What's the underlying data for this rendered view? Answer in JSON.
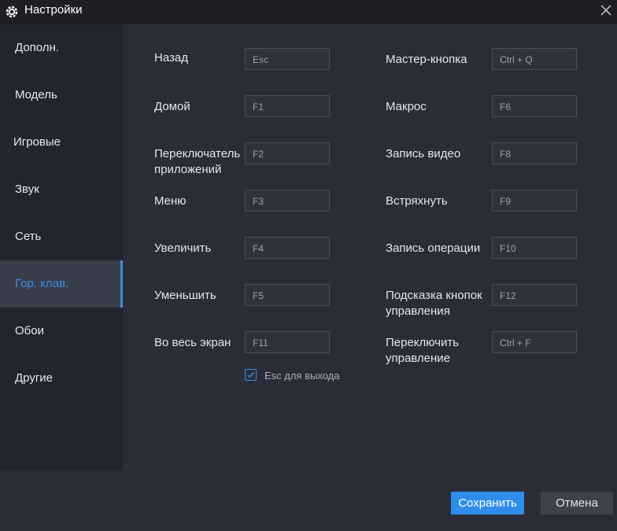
{
  "window": {
    "title": "Настройки"
  },
  "sidebar": {
    "items": [
      {
        "label": "Дополн."
      },
      {
        "label": "Модель"
      },
      {
        "label": "Игровые"
      },
      {
        "label": "Звук"
      },
      {
        "label": "Сеть"
      },
      {
        "label": "Гор. клав.",
        "active": true
      },
      {
        "label": "Обои"
      },
      {
        "label": "Другие"
      }
    ]
  },
  "hotkeys": {
    "left": [
      {
        "label": "Назад",
        "key": "Esc"
      },
      {
        "label": "Домой",
        "key": "F1"
      },
      {
        "label": "Переключатель приложений",
        "key": "F2"
      },
      {
        "label": "Меню",
        "key": "F3"
      },
      {
        "label": "Увеличить",
        "key": "F4"
      },
      {
        "label": "Уменьшить",
        "key": "F5"
      },
      {
        "label": "Во весь экран",
        "key": "F11"
      }
    ],
    "right": [
      {
        "label": "Мастер-кнопка",
        "key": "Ctrl + Q"
      },
      {
        "label": "Макрос",
        "key": "F6"
      },
      {
        "label": "Запись видео",
        "key": "F8"
      },
      {
        "label": "Встряхнуть",
        "key": "F9"
      },
      {
        "label": "Запись операции",
        "key": "F10"
      },
      {
        "label": "Подсказка кнопок управления",
        "key": "F12"
      },
      {
        "label": "Переключить управление",
        "key": "Ctrl + F"
      }
    ],
    "esc_exit": {
      "label": "Esc для выхода",
      "checked": true
    }
  },
  "footer": {
    "save_label": "Сохранить",
    "cancel_label": "Отмена"
  },
  "colors": {
    "accent": "#3d8be6",
    "save_button": "#2f8de9",
    "background": "#2a2d37",
    "sidebar": "#22252d"
  }
}
